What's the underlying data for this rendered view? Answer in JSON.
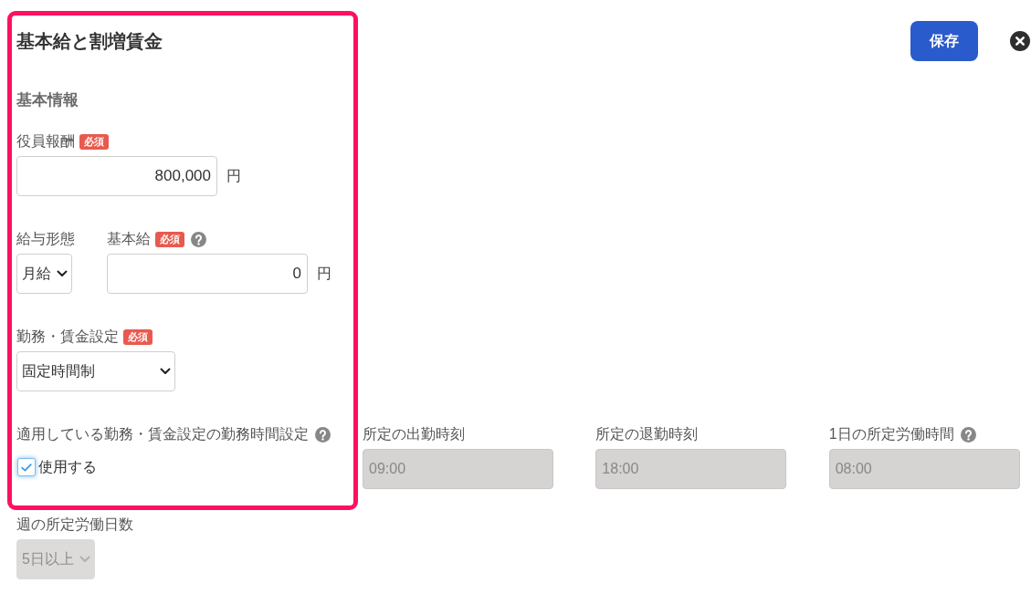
{
  "header": {
    "title": "基本給と割増賃金",
    "save_button": "保存"
  },
  "highlight_frame": true,
  "section_title": "基本情報",
  "rows": [
    {
      "fields": [
        {
          "kind": "number",
          "label": "役員報酬",
          "badge": "必須",
          "value": "800,000",
          "unit": "円",
          "disabled": false
        }
      ]
    },
    {
      "fields": [
        {
          "kind": "select",
          "label": "給与形態",
          "value": "月給",
          "disabled": false
        },
        {
          "kind": "number",
          "label": "基本給",
          "badge": "必須",
          "help": true,
          "value": "0",
          "unit": "円",
          "disabled": false
        }
      ]
    },
    {
      "fields": [
        {
          "kind": "select",
          "label": "勤務・賃金設定",
          "badge": "必須",
          "value": "固定時間制",
          "disabled": false
        }
      ]
    },
    {
      "fields": [
        {
          "kind": "checkbox",
          "label": "適用している勤務・賃金設定の勤務時間設定",
          "help": true,
          "text": "使用する",
          "checked": true
        },
        {
          "kind": "time",
          "label": "所定の出勤時刻",
          "value": "09:00",
          "disabled": true
        },
        {
          "kind": "time",
          "label": "所定の退勤時刻",
          "value": "18:00",
          "disabled": true
        },
        {
          "kind": "time",
          "label": "1日の所定労働時間",
          "help": true,
          "value": "08:00",
          "disabled": true
        }
      ]
    },
    {
      "fields": [
        {
          "kind": "select",
          "label": "週の所定労働日数",
          "value": "5日以上",
          "disabled": true
        }
      ]
    }
  ]
}
